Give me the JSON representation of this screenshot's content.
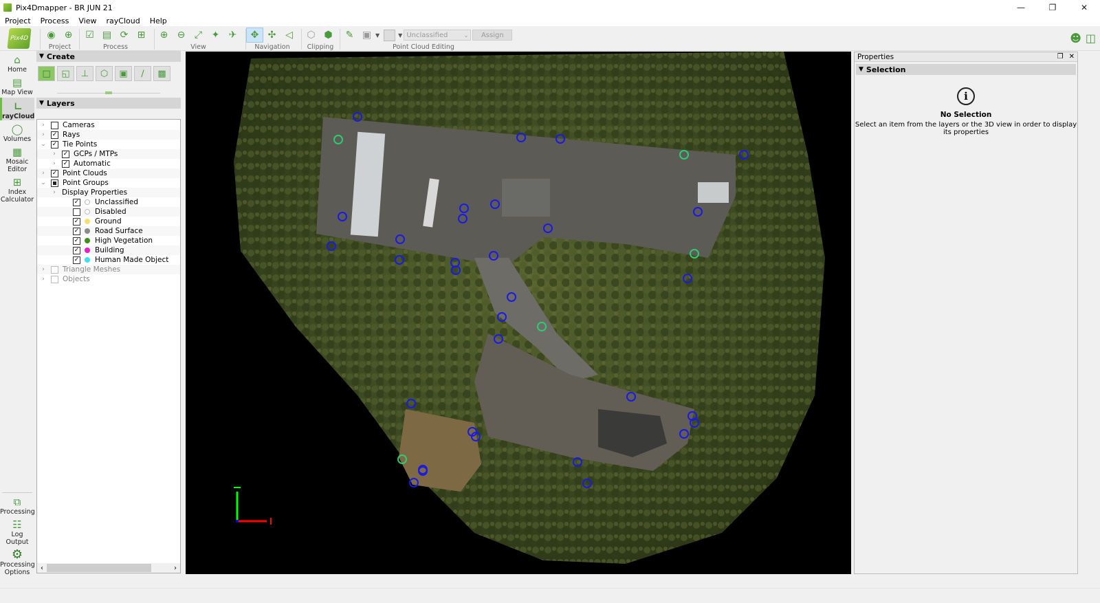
{
  "window": {
    "title": "Pix4Dmapper - BR JUN 21",
    "controls": [
      "minimize",
      "restore",
      "close"
    ]
  },
  "menu": [
    "Project",
    "Process",
    "View",
    "rayCloud",
    "Help"
  ],
  "toolbar": {
    "logo_text": "Pix4D",
    "groups": [
      {
        "label": "Project",
        "icons": [
          "camera-icon",
          "gcp-target-icon"
        ]
      },
      {
        "label": "Process",
        "icons": [
          "document-check-icon",
          "open-folder-icon",
          "rerun-icon",
          "process-step-icon"
        ]
      },
      {
        "label": "View",
        "icons": [
          "zoom-in-icon",
          "zoom-out-icon",
          "zoom-fit-icon",
          "zoom-center-icon",
          "fly-icon"
        ]
      },
      {
        "label": "Navigation",
        "icons": [
          "orbit-nav-icon",
          "trackball-nav-icon",
          "perspective-nav-icon"
        ]
      },
      {
        "label": "Clipping",
        "icons": [
          "clip-box-icon",
          "clip-edit-icon"
        ]
      },
      {
        "label": "Point Cloud Editing",
        "icons": [
          "brush-icon",
          "select-point-icon"
        ]
      }
    ],
    "class_select": {
      "value": "Unclassified"
    },
    "assign_label": "Assign",
    "right_icons": [
      "user-icon",
      "panel-layout-icon"
    ]
  },
  "sidebar": {
    "items": [
      {
        "label": "Home",
        "icon": "home-icon",
        "active": false
      },
      {
        "label": "Map View",
        "icon": "map-icon",
        "active": false
      },
      {
        "label": "rayCloud",
        "icon": "raycloud-icon",
        "active": true
      },
      {
        "label": "Volumes",
        "icon": "volumes-icon",
        "active": false
      },
      {
        "label": "Mosaic Editor",
        "icon": "mosaic-icon",
        "active": false
      },
      {
        "label": "Index Calculator",
        "icon": "calculator-icon",
        "active": false
      }
    ],
    "bottom_items": [
      {
        "label": "Processing",
        "icon": "processing-icon"
      },
      {
        "label": "Log Output",
        "icon": "log-icon"
      },
      {
        "label": "Processing Options",
        "icon": "gear-icon"
      }
    ]
  },
  "create": {
    "title": "Create",
    "tools": [
      "polyline-area-icon",
      "surface-icon",
      "axis-icon",
      "volume-icon",
      "video-camera-icon",
      "line-icon",
      "grid-area-icon"
    ]
  },
  "layers": {
    "title": "Layers",
    "items": [
      {
        "label": "Cameras",
        "level": 0,
        "expander": "closed",
        "checked": "no"
      },
      {
        "label": "Rays",
        "level": 0,
        "expander": "closed",
        "checked": "yes"
      },
      {
        "label": "Tie Points",
        "level": 0,
        "expander": "open",
        "checked": "yes"
      },
      {
        "label": "GCPs / MTPs",
        "level": 1,
        "expander": "closed",
        "checked": "yes"
      },
      {
        "label": "Automatic",
        "level": 1,
        "expander": "closed",
        "checked": "yes"
      },
      {
        "label": "Point Clouds",
        "level": 0,
        "expander": "closed",
        "checked": "yes"
      },
      {
        "label": "Point Groups",
        "level": 0,
        "expander": "open",
        "checked": "partial"
      },
      {
        "label": "Display Properties",
        "level": 1,
        "expander": "closed",
        "checked": "none"
      },
      {
        "label": "Unclassified",
        "level": 2,
        "checked": "yes",
        "color": "#ffffff"
      },
      {
        "label": "Disabled",
        "level": 2,
        "checked": "no",
        "color": "#ffffff"
      },
      {
        "label": "Ground",
        "level": 2,
        "checked": "yes",
        "color": "#f5e06e"
      },
      {
        "label": "Road Surface",
        "level": 2,
        "checked": "yes",
        "color": "#8a8a8a"
      },
      {
        "label": "High Vegetation",
        "level": 2,
        "checked": "yes",
        "color": "#3f8f1f"
      },
      {
        "label": "Building",
        "level": 2,
        "checked": "yes",
        "color": "#e81ec8"
      },
      {
        "label": "Human Made Object",
        "level": 2,
        "checked": "yes",
        "color": "#3de0ee"
      },
      {
        "label": "Triangle Meshes",
        "level": 0,
        "expander": "closed",
        "checked": "disabled"
      },
      {
        "label": "Objects",
        "level": 0,
        "expander": "closed",
        "checked": "disabled"
      }
    ]
  },
  "viewport": {
    "gcp_color": "#1a1ae6",
    "checkpoint_color": "#2ecc71",
    "axis_colors": {
      "x": "#ff0000",
      "y": "#00ff00",
      "z": "#0000ff"
    }
  },
  "properties": {
    "title": "Properties",
    "section": "Selection",
    "no_selection_title": "No Selection",
    "no_selection_desc": "Select an item from the layers or the 3D view in order to display its properties"
  }
}
